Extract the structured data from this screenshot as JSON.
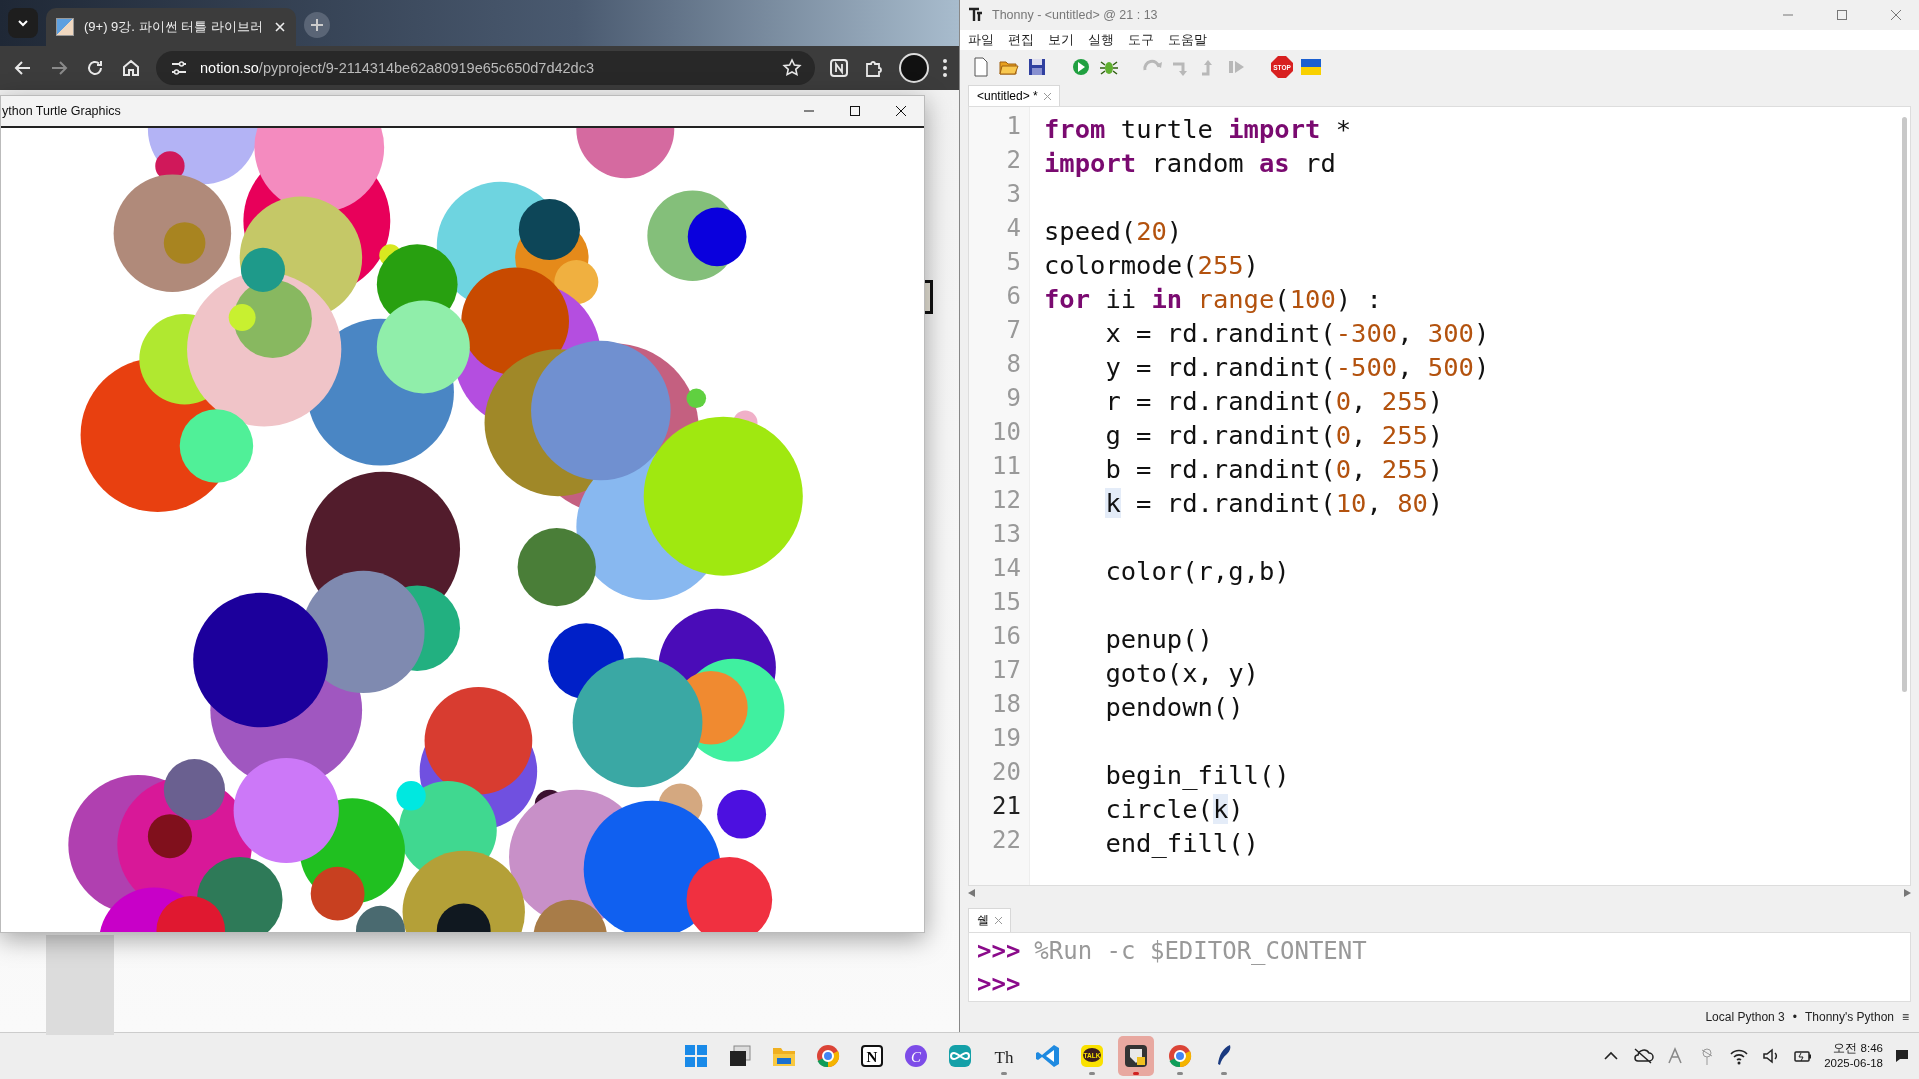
{
  "browser": {
    "tab": {
      "title": "(9+) 9강. 파이썬 터틀 라이브러",
      "selected": true
    },
    "address": {
      "host": "notion.so",
      "path": "/pyproject/9-2114314be62a80919e65c650d7d42dc3"
    }
  },
  "turtle_window": {
    "title": "ython Turtle Graphics"
  },
  "thonny": {
    "title": "Thonny  -  <untitled>  @  21 : 13",
    "menu": [
      "파일",
      "편집",
      "보기",
      "실행",
      "도구",
      "도움말"
    ],
    "toolbar": [
      {
        "kind": "new",
        "disabled": false
      },
      {
        "kind": "open",
        "disabled": false
      },
      {
        "kind": "save",
        "disabled": false
      },
      {
        "kind": "run",
        "disabled": false
      },
      {
        "kind": "debug",
        "disabled": false
      },
      {
        "kind": "step-over",
        "disabled": true
      },
      {
        "kind": "step-into",
        "disabled": true
      },
      {
        "kind": "step-out",
        "disabled": true
      },
      {
        "kind": "resume",
        "disabled": true
      },
      {
        "kind": "stop",
        "disabled": false,
        "glyph": "STOP"
      },
      {
        "kind": "flag",
        "disabled": false
      }
    ],
    "editor_tab": {
      "label": "<untitled> *",
      "selected": true
    },
    "lines": [
      {
        "number": "1",
        "current": false,
        "tokens": [
          {
            "text": "from",
            "kind": "keyword"
          },
          {
            "text": " turtle ",
            "kind": "plain"
          },
          {
            "text": "import",
            "kind": "keyword"
          },
          {
            "text": " *",
            "kind": "plain"
          }
        ]
      },
      {
        "number": "2",
        "current": false,
        "tokens": [
          {
            "text": "import",
            "kind": "keyword"
          },
          {
            "text": " random ",
            "kind": "plain"
          },
          {
            "text": "as",
            "kind": "keyword"
          },
          {
            "text": " rd",
            "kind": "plain"
          }
        ]
      },
      {
        "number": "3",
        "current": false
      },
      {
        "number": "4",
        "current": false,
        "tokens": [
          {
            "text": "speed(",
            "kind": "plain"
          },
          {
            "text": "20",
            "kind": "number"
          },
          {
            "text": ")",
            "kind": "plain"
          }
        ]
      },
      {
        "number": "5",
        "current": false,
        "tokens": [
          {
            "text": "colormode(",
            "kind": "plain"
          },
          {
            "text": "255",
            "kind": "number"
          },
          {
            "text": ")",
            "kind": "plain"
          }
        ]
      },
      {
        "number": "6",
        "current": false,
        "tokens": [
          {
            "text": "for",
            "kind": "keyword"
          },
          {
            "text": " ii ",
            "kind": "plain"
          },
          {
            "text": "in",
            "kind": "keyword"
          },
          {
            "text": " range",
            "kind": "builtin"
          },
          {
            "text": "(",
            "kind": "plain"
          },
          {
            "text": "100",
            "kind": "number"
          },
          {
            "text": ") :",
            "kind": "plain"
          }
        ]
      },
      {
        "number": "7",
        "current": false,
        "indented": true,
        "tokens": [
          {
            "text": "x = rd.randint(",
            "kind": "plain"
          },
          {
            "text": "-300",
            "kind": "number"
          },
          {
            "text": ", ",
            "kind": "plain"
          },
          {
            "text": "300",
            "kind": "number"
          },
          {
            "text": ")",
            "kind": "plain"
          }
        ]
      },
      {
        "number": "8",
        "current": false,
        "indented": true,
        "tokens": [
          {
            "text": "y = rd.randint(",
            "kind": "plain"
          },
          {
            "text": "-500",
            "kind": "number"
          },
          {
            "text": ", ",
            "kind": "plain"
          },
          {
            "text": "500",
            "kind": "number"
          },
          {
            "text": ")",
            "kind": "plain"
          }
        ]
      },
      {
        "number": "9",
        "current": false,
        "indented": true,
        "tokens": [
          {
            "text": "r = rd.randint(",
            "kind": "plain"
          },
          {
            "text": "0",
            "kind": "number"
          },
          {
            "text": ", ",
            "kind": "plain"
          },
          {
            "text": "255",
            "kind": "number"
          },
          {
            "text": ")",
            "kind": "plain"
          }
        ]
      },
      {
        "number": "10",
        "current": false,
        "indented": true,
        "tokens": [
          {
            "text": "g = rd.randint(",
            "kind": "plain"
          },
          {
            "text": "0",
            "kind": "number"
          },
          {
            "text": ", ",
            "kind": "plain"
          },
          {
            "text": "255",
            "kind": "number"
          },
          {
            "text": ")",
            "kind": "plain"
          }
        ]
      },
      {
        "number": "11",
        "current": false,
        "indented": true,
        "tokens": [
          {
            "text": "b = rd.randint(",
            "kind": "plain"
          },
          {
            "text": "0",
            "kind": "number"
          },
          {
            "text": ", ",
            "kind": "plain"
          },
          {
            "text": "255",
            "kind": "number"
          },
          {
            "text": ")",
            "kind": "plain"
          }
        ]
      },
      {
        "number": "12",
        "current": false,
        "indented": true,
        "tokens": [
          {
            "text": "k",
            "kind": "highlight"
          },
          {
            "text": " = rd.randint(",
            "kind": "plain"
          },
          {
            "text": "10",
            "kind": "number"
          },
          {
            "text": ", ",
            "kind": "plain"
          },
          {
            "text": "80",
            "kind": "number"
          },
          {
            "text": ")",
            "kind": "plain"
          }
        ]
      },
      {
        "number": "13",
        "current": false
      },
      {
        "number": "14",
        "current": false,
        "indented": true,
        "tokens": [
          {
            "text": "color(r,g,b)",
            "kind": "plain"
          }
        ]
      },
      {
        "number": "15",
        "current": false
      },
      {
        "number": "16",
        "current": false,
        "indented": true,
        "tokens": [
          {
            "text": "penup()",
            "kind": "plain"
          }
        ]
      },
      {
        "number": "17",
        "current": false,
        "indented": true,
        "tokens": [
          {
            "text": "goto(x, y)",
            "kind": "plain"
          }
        ]
      },
      {
        "number": "18",
        "current": false,
        "indented": true,
        "tokens": [
          {
            "text": "pendown()",
            "kind": "plain"
          }
        ]
      },
      {
        "number": "19",
        "current": false
      },
      {
        "number": "20",
        "current": false,
        "indented": true,
        "tokens": [
          {
            "text": "begin_fill()",
            "kind": "plain"
          }
        ]
      },
      {
        "number": "21",
        "current": true,
        "indented": true,
        "tokens": [
          {
            "text": "circle(",
            "kind": "plain"
          },
          {
            "text": "k",
            "kind": "highlight"
          },
          {
            "text": ")",
            "kind": "plain"
          }
        ]
      },
      {
        "number": "22",
        "current": false,
        "indented": true,
        "tokens": [
          {
            "text": "end_fill()",
            "kind": "plain"
          }
        ]
      }
    ],
    "shell_tab": {
      "label": "쉘",
      "selected": true
    },
    "shell": [
      {
        "prompt": ">>>",
        "command": "%Run -c $EDITOR_CONTENT"
      },
      {
        "prompt": ">>>"
      }
    ],
    "status": [
      "Local Python 3",
      "•",
      "Thonny's Python",
      "≡"
    ]
  },
  "taskbar": {
    "apps": [
      {
        "kind": "start",
        "open": false,
        "selected": false
      },
      {
        "kind": "taskview",
        "open": false,
        "selected": false
      },
      {
        "kind": "folder",
        "open": false,
        "selected": false
      },
      {
        "kind": "chrome",
        "open": false,
        "selected": false
      },
      {
        "kind": "notion",
        "glyph": "N",
        "open": false,
        "selected": false
      },
      {
        "kind": "canva",
        "glyph": "C",
        "open": false,
        "selected": false
      },
      {
        "kind": "arduino",
        "open": false,
        "selected": false
      },
      {
        "kind": "thonny",
        "glyph": "Th",
        "open": true,
        "selected": false
      },
      {
        "kind": "vscode",
        "open": false,
        "selected": false
      },
      {
        "kind": "kakao",
        "glyph": "TALK",
        "open": true,
        "selected": false
      },
      {
        "kind": "tool",
        "open": true,
        "selected": true
      },
      {
        "kind": "chrome",
        "open": true,
        "selected": false
      },
      {
        "kind": "feather",
        "open": true,
        "selected": false
      }
    ],
    "tray": [
      {
        "kind": "chevron"
      },
      {
        "kind": "cloud-off"
      },
      {
        "kind": "font"
      },
      {
        "kind": "pin"
      },
      {
        "kind": "wifi"
      },
      {
        "kind": "speaker"
      },
      {
        "kind": "battery"
      }
    ],
    "clock": {
      "time": "오전 8:46",
      "date": "2025-06-18"
    }
  }
}
